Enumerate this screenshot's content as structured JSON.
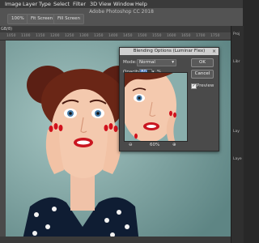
{
  "menubar": {
    "items": [
      "Image",
      "Layer",
      "Type",
      "Select",
      "Filter",
      "3D",
      "View",
      "Window",
      "Help"
    ]
  },
  "options_bar": {
    "app_title": "Adobe Photoshop CC 2018",
    "buttons": [
      "100%",
      "Fit Screen",
      "Fill Screen"
    ]
  },
  "document_tab": {
    "label": "GB/8)"
  },
  "ruler": {
    "ticks": [
      "1050",
      "1100",
      "1150",
      "1200",
      "1250",
      "1300",
      "1350",
      "1400",
      "1450",
      "1500",
      "1550",
      "1600",
      "1650",
      "1700",
      "1750"
    ]
  },
  "right_panel": {
    "labels": [
      "Proj",
      "Libr",
      "Lay",
      "Laye"
    ]
  },
  "dialog": {
    "title": "Blending Options (Luminar Flex)",
    "mode_label": "Mode:",
    "mode_value": "Normal",
    "opacity_label": "Opacity:",
    "opacity_value": "80",
    "opacity_unit": "%",
    "ok_label": "OK",
    "cancel_label": "Cancel",
    "preview_label": "Preview",
    "preview_checked": true,
    "zoom_value": "60%",
    "zoom_out_symbol": "⊖",
    "zoom_in_symbol": "⊕",
    "close_symbol": "×"
  },
  "colors": {
    "canvas_background": "#7fa5a3",
    "dialog_background": "#4a4a4a",
    "selection_highlight": "#3d6fb8"
  }
}
